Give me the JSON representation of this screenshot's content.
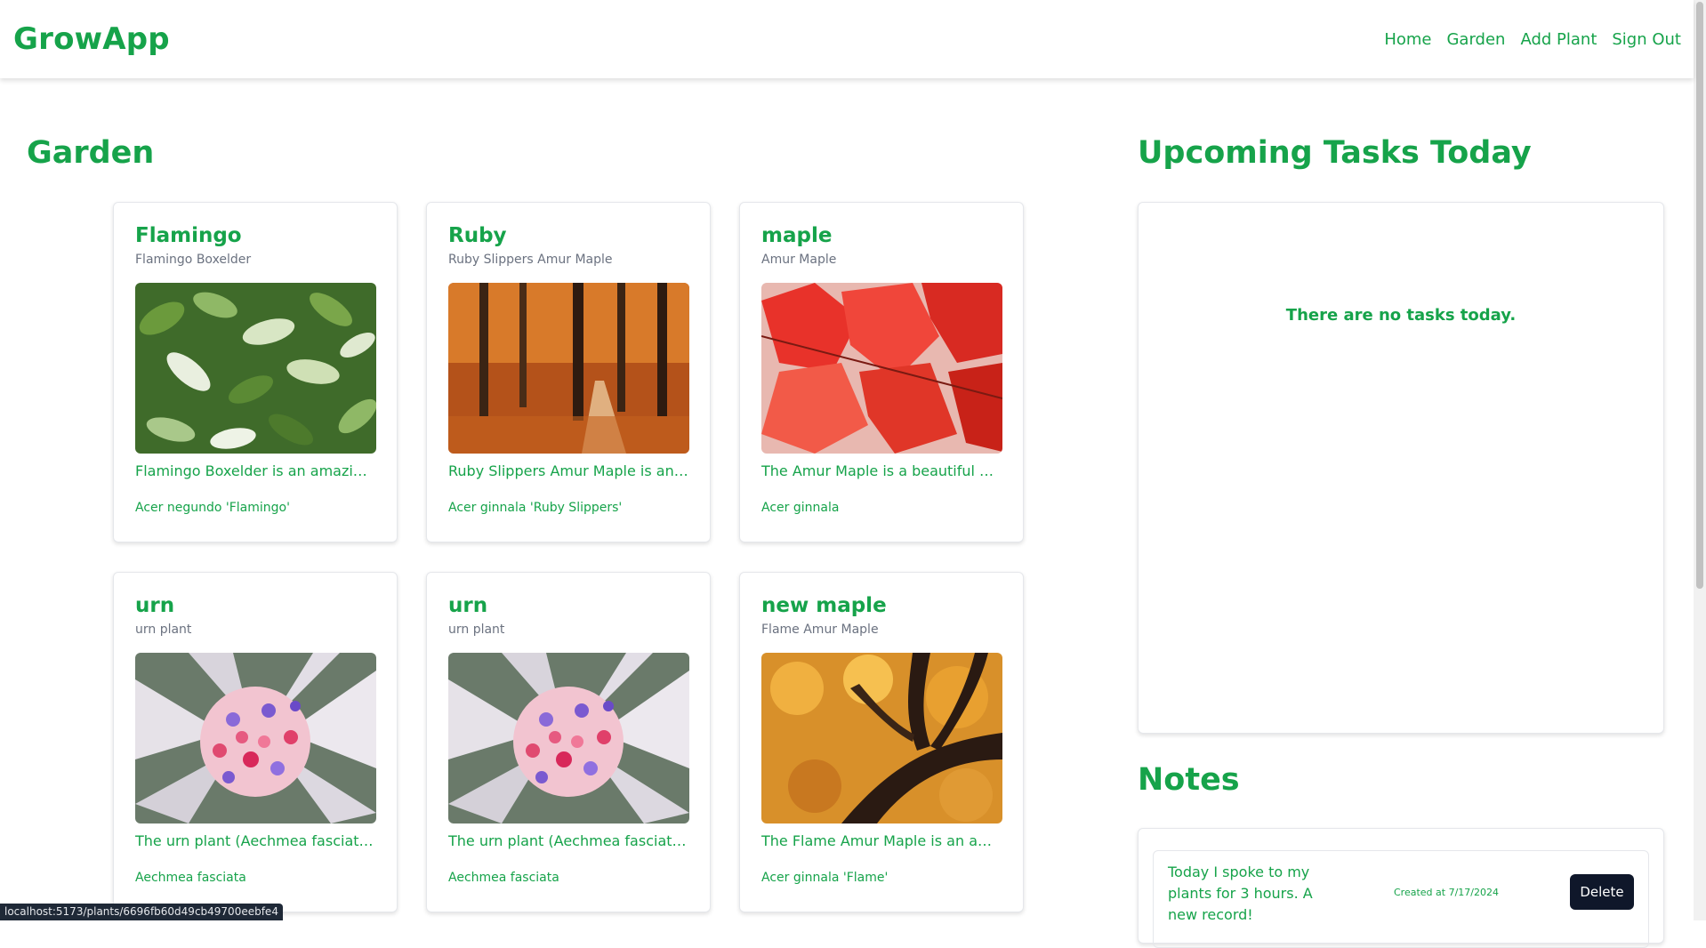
{
  "app": {
    "brand": "GrowApp"
  },
  "nav": {
    "links": [
      "Home",
      "Garden",
      "Add Plant",
      "Sign Out"
    ]
  },
  "garden": {
    "title": "Garden",
    "plants": [
      {
        "name": "Flamingo",
        "common": "Flamingo Boxelder",
        "description": "Flamingo Boxelder is an amazing an...",
        "scientific": "Acer negundo 'Flamingo'",
        "image": "variegated-leaves"
      },
      {
        "name": "Ruby",
        "common": "Ruby Slippers Amur Maple",
        "description": "Ruby Slippers Amur Maple is an am...",
        "scientific": "Acer ginnala 'Ruby Slippers'",
        "image": "autumn-forest"
      },
      {
        "name": "maple",
        "common": "Amur Maple",
        "description": "The Amur Maple is a beautiful and v...",
        "scientific": "Acer ginnala",
        "image": "red-maple-leaves"
      },
      {
        "name": "urn",
        "common": "urn plant",
        "description": "The urn plant (Aechmea fasciata) is ...",
        "scientific": "Aechmea fasciata",
        "image": "urn-flower"
      },
      {
        "name": "urn",
        "common": "urn plant",
        "description": "The urn plant (Aechmea fasciata) is ...",
        "scientific": "Aechmea fasciata",
        "image": "urn-flower"
      },
      {
        "name": "new maple",
        "common": "Flame Amur Maple",
        "description": "The Flame Amur Maple is an amazi...",
        "scientific": "Acer ginnala 'Flame'",
        "image": "orange-tree-canopy"
      }
    ]
  },
  "tasks": {
    "title": "Upcoming Tasks Today",
    "empty_message": "There are no tasks today."
  },
  "notes": {
    "title": "Notes",
    "items": [
      {
        "text": "Today I spoke to my plants for 3 hours. A new record!",
        "created": "Created at 7/17/2024",
        "delete_label": "Delete"
      }
    ]
  },
  "status_bar": {
    "url": "localhost:5173/plants/6696fb60d49cb49700eebfe4"
  },
  "colors": {
    "accent": "#16a34a",
    "muted": "#6b7280",
    "button_dark": "#0f172a"
  }
}
